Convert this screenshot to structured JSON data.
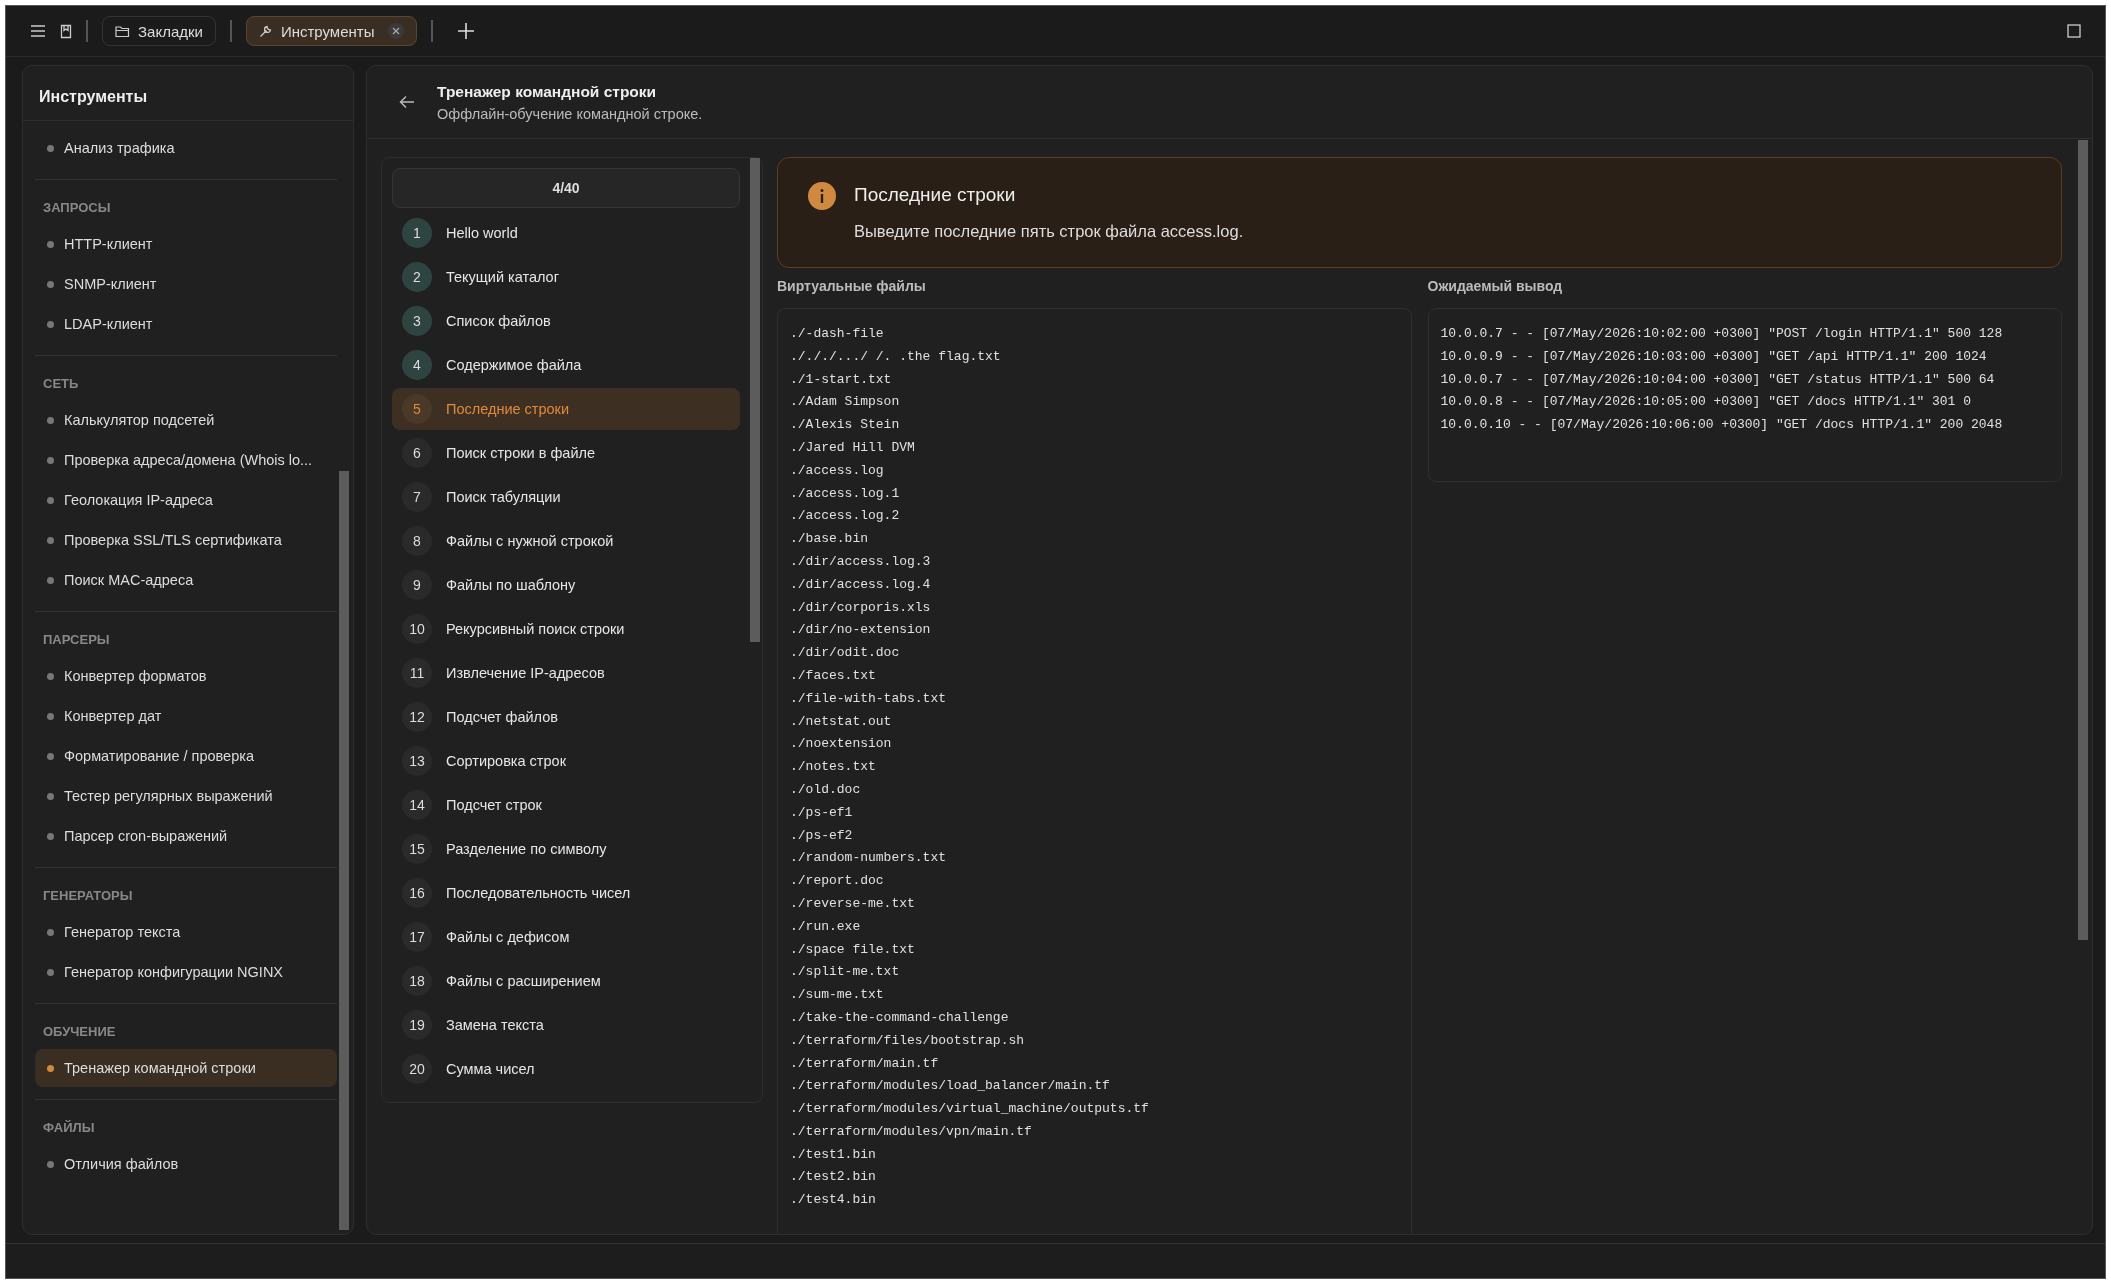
{
  "toolbar": {
    "tabs": [
      {
        "label": "Закладки",
        "selected": false,
        "closable": false
      },
      {
        "label": "Инструменты",
        "selected": true,
        "closable": true
      }
    ]
  },
  "sidebar": {
    "title": "Инструменты",
    "sections": [
      {
        "items": [
          {
            "label": "Анализ трафика",
            "selected": false
          }
        ]
      },
      {
        "heading": "ЗАПРОСЫ",
        "items": [
          {
            "label": "HTTP-клиент",
            "selected": false
          },
          {
            "label": "SNMP-клиент",
            "selected": false
          },
          {
            "label": "LDAP-клиент",
            "selected": false
          }
        ]
      },
      {
        "heading": "СЕТЬ",
        "items": [
          {
            "label": "Калькулятор подсетей",
            "selected": false
          },
          {
            "label": "Проверка адреса/домена (Whois lo...",
            "selected": false
          },
          {
            "label": "Геолокация IP-адреса",
            "selected": false
          },
          {
            "label": "Проверка SSL/TLS сертификата",
            "selected": false
          },
          {
            "label": "Поиск MAC-адреса",
            "selected": false
          }
        ]
      },
      {
        "heading": "ПАРСЕРЫ",
        "items": [
          {
            "label": "Конвертер форматов",
            "selected": false
          },
          {
            "label": "Конвертер дат",
            "selected": false
          },
          {
            "label": "Форматирование / проверка",
            "selected": false
          },
          {
            "label": "Тестер регулярных выражений",
            "selected": false
          },
          {
            "label": "Парсер cron-выражений",
            "selected": false
          }
        ]
      },
      {
        "heading": "ГЕНЕРАТОРЫ",
        "items": [
          {
            "label": "Генератор текста",
            "selected": false
          },
          {
            "label": "Генератор конфигурации NGINX",
            "selected": false
          }
        ]
      },
      {
        "heading": "ОБУЧЕНИЕ",
        "items": [
          {
            "label": "Тренажер командной строки",
            "selected": true
          }
        ]
      },
      {
        "heading": "ФАЙЛЫ",
        "items": [
          {
            "label": "Отличия файлов",
            "selected": false
          }
        ]
      }
    ]
  },
  "page": {
    "title": "Тренажер командной строки",
    "subtitle": "Оффлайн-обучение командной строке."
  },
  "tasks": {
    "counter": "4/40",
    "items": [
      {
        "number": "1",
        "label": "Hello world",
        "done": true,
        "selected": false
      },
      {
        "number": "2",
        "label": "Текущий каталог",
        "done": true,
        "selected": false
      },
      {
        "number": "3",
        "label": "Список файлов",
        "done": true,
        "selected": false
      },
      {
        "number": "4",
        "label": "Содержимое файла",
        "done": true,
        "selected": false
      },
      {
        "number": "5",
        "label": "Последние строки",
        "done": false,
        "selected": true
      },
      {
        "number": "6",
        "label": "Поиск строки в файле",
        "done": false,
        "selected": false
      },
      {
        "number": "7",
        "label": "Поиск табуляции",
        "done": false,
        "selected": false
      },
      {
        "number": "8",
        "label": "Файлы с нужной строкой",
        "done": false,
        "selected": false
      },
      {
        "number": "9",
        "label": "Файлы по шаблону",
        "done": false,
        "selected": false
      },
      {
        "number": "10",
        "label": "Рекурсивный поиск строки",
        "done": false,
        "selected": false
      },
      {
        "number": "11",
        "label": "Извлечение IP-адресов",
        "done": false,
        "selected": false
      },
      {
        "number": "12",
        "label": "Подсчет файлов",
        "done": false,
        "selected": false
      },
      {
        "number": "13",
        "label": "Сортировка строк",
        "done": false,
        "selected": false
      },
      {
        "number": "14",
        "label": "Подсчет строк",
        "done": false,
        "selected": false
      },
      {
        "number": "15",
        "label": "Разделение по символу",
        "done": false,
        "selected": false
      },
      {
        "number": "16",
        "label": "Последовательность чисел",
        "done": false,
        "selected": false
      },
      {
        "number": "17",
        "label": "Файлы с дефисом",
        "done": false,
        "selected": false
      },
      {
        "number": "18",
        "label": "Файлы с расширением",
        "done": false,
        "selected": false
      },
      {
        "number": "19",
        "label": "Замена текста",
        "done": false,
        "selected": false
      },
      {
        "number": "20",
        "label": "Сумма чисел",
        "done": false,
        "selected": false
      }
    ]
  },
  "task_card": {
    "title": "Последние строки",
    "description": "Выведите последние пять строк файла access.log."
  },
  "files": {
    "heading": "Виртуальные файлы",
    "lines": [
      "./-dash-file",
      "./././.../ /. .the flag.txt",
      "./1-start.txt",
      "./Adam Simpson",
      "./Alexis Stein",
      "./Jared Hill DVM",
      "./access.log",
      "./access.log.1",
      "./access.log.2",
      "./base.bin",
      "./dir/access.log.3",
      "./dir/access.log.4",
      "./dir/corporis.xls",
      "./dir/no-extension",
      "./dir/odit.doc",
      "./faces.txt",
      "./file-with-tabs.txt",
      "./netstat.out",
      "./noextension",
      "./notes.txt",
      "./old.doc",
      "./ps-ef1",
      "./ps-ef2",
      "./random-numbers.txt",
      "./report.doc",
      "./reverse-me.txt",
      "./run.exe",
      "./space file.txt",
      "./split-me.txt",
      "./sum-me.txt",
      "./take-the-command-challenge",
      "./terraform/files/bootstrap.sh",
      "./terraform/main.tf",
      "./terraform/modules/load_balancer/main.tf",
      "./terraform/modules/virtual_machine/outputs.tf",
      "./terraform/modules/vpn/main.tf",
      "./test1.bin",
      "./test2.bin",
      "./test4.bin"
    ]
  },
  "expected": {
    "heading": "Ожидаемый вывод",
    "lines": [
      "10.0.0.7 - - [07/May/2026:10:02:00 +0300] \"POST /login HTTP/1.1\" 500 128",
      "10.0.0.9 - - [07/May/2026:10:03:00 +0300] \"GET /api HTTP/1.1\" 200 1024",
      "10.0.0.7 - - [07/May/2026:10:04:00 +0300] \"GET /status HTTP/1.1\" 500 64",
      "10.0.0.8 - - [07/May/2026:10:05:00 +0300] \"GET /docs HTTP/1.1\" 301 0",
      "10.0.0.10 - - [07/May/2026:10:06:00 +0300] \"GET /docs HTTP/1.1\" 200 2048"
    ]
  }
}
